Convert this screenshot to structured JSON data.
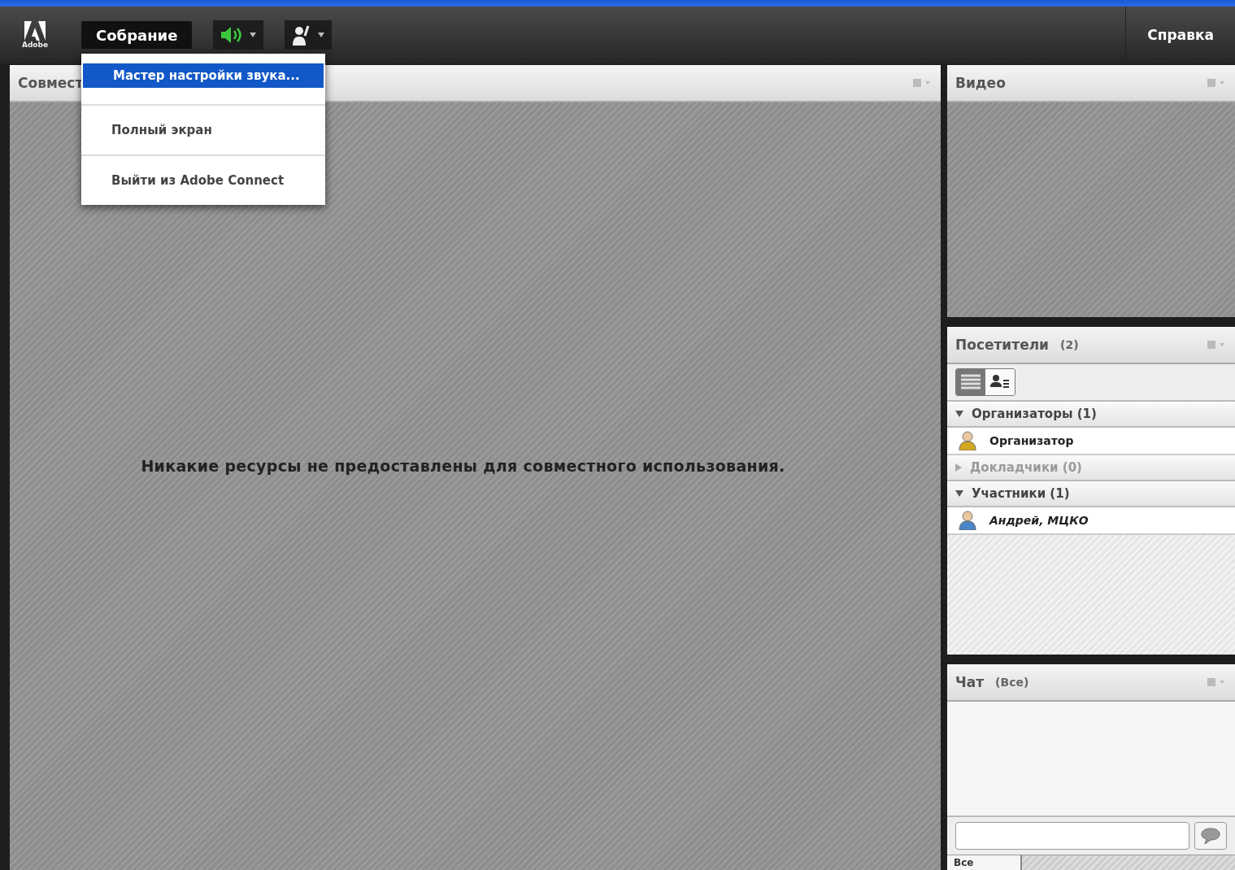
{
  "toolbar": {
    "logo_text": "Adobe",
    "menus": [
      {
        "label": "Собрание",
        "selected": true
      }
    ],
    "speaker_on": true,
    "help": "Справка"
  },
  "menu": {
    "items": [
      {
        "label": "Мастер настройки звука...",
        "selected": true
      },
      {
        "label": "Полный экран",
        "selected": false
      },
      {
        "label": "Выйти из Adobe Connect",
        "selected": false
      }
    ]
  },
  "share_pod": {
    "title": "Совмест",
    "message": "Никакие ресурсы не предоставлены для совместного использования."
  },
  "video_pod": {
    "title": "Видео"
  },
  "attendees_pod": {
    "title": "Посетители",
    "count": "(2)",
    "groups": [
      {
        "label": "Организаторы (1)",
        "expanded": true,
        "disabled": false,
        "children": [
          {
            "name": "Организатор",
            "kind": "host"
          }
        ]
      },
      {
        "label": "Докладчики (0)",
        "expanded": false,
        "disabled": true
      },
      {
        "label": "Участники (1)",
        "expanded": true,
        "disabled": false,
        "children": [
          {
            "name": "Андрей, МЦКО",
            "kind": "participant"
          }
        ]
      }
    ]
  },
  "chat_pod": {
    "title": "Чат",
    "scope": "(Все)",
    "tabs": [
      {
        "label": "Все",
        "selected": true
      }
    ]
  }
}
